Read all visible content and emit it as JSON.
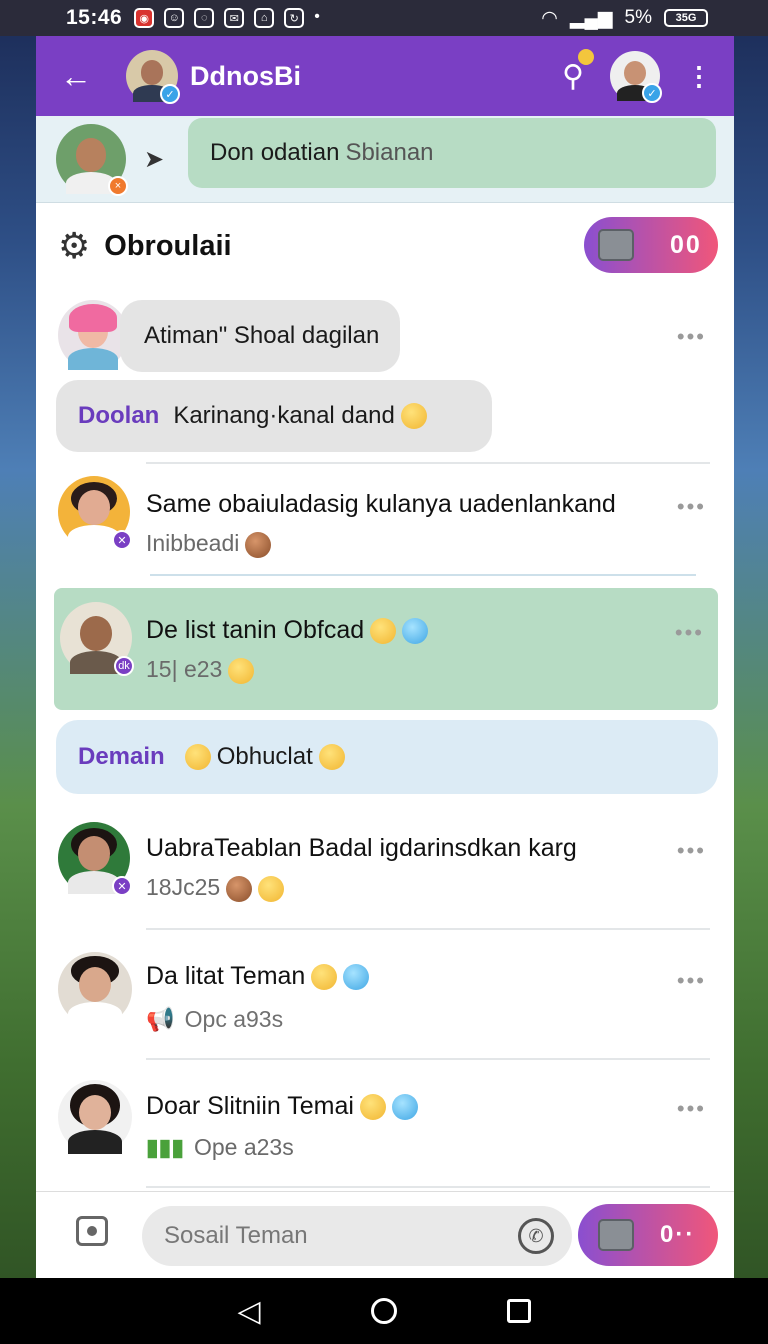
{
  "status_bar": {
    "time": "15:46",
    "battery_text": "5%",
    "battery_label": "35G"
  },
  "header": {
    "title": "DdnosBi"
  },
  "pinned": {
    "text": "Don odatian",
    "muted": "Sbianan"
  },
  "group": {
    "title": "Obroulaii",
    "gem_count": "00"
  },
  "bubbles": [
    {
      "text": "Atiman\" Shoal dagilan"
    },
    {
      "label": "Doolan",
      "text": "Karinang·kanal dand"
    },
    {
      "label": "Demain",
      "text": "Obhuclat"
    }
  ],
  "chats": [
    {
      "title": "Same obaiuladasig kulanya uadenlankand",
      "sub": "Inibbeadi",
      "highlighted": false
    },
    {
      "title": "De list tanin Obfcad",
      "sub": "15| e23",
      "highlighted": true
    },
    {
      "title": "UabraTeablan Badal igdarinsdkan karg",
      "sub": "18Jc25",
      "highlighted": false
    },
    {
      "title": "Da litat Teman",
      "sub": "Opc a93s",
      "highlighted": false
    },
    {
      "title": "Doar Slitniin Temai",
      "sub": "Ope a23s",
      "highlighted": false
    }
  ],
  "composer": {
    "placeholder": "Sosail Teman",
    "pill_count": "0··"
  },
  "colors": {
    "header": "#7a3fc4",
    "accent_gradient_start": "#8a4fd0",
    "accent_gradient_end": "#f0567a",
    "highlight": "#b7dcc4"
  }
}
